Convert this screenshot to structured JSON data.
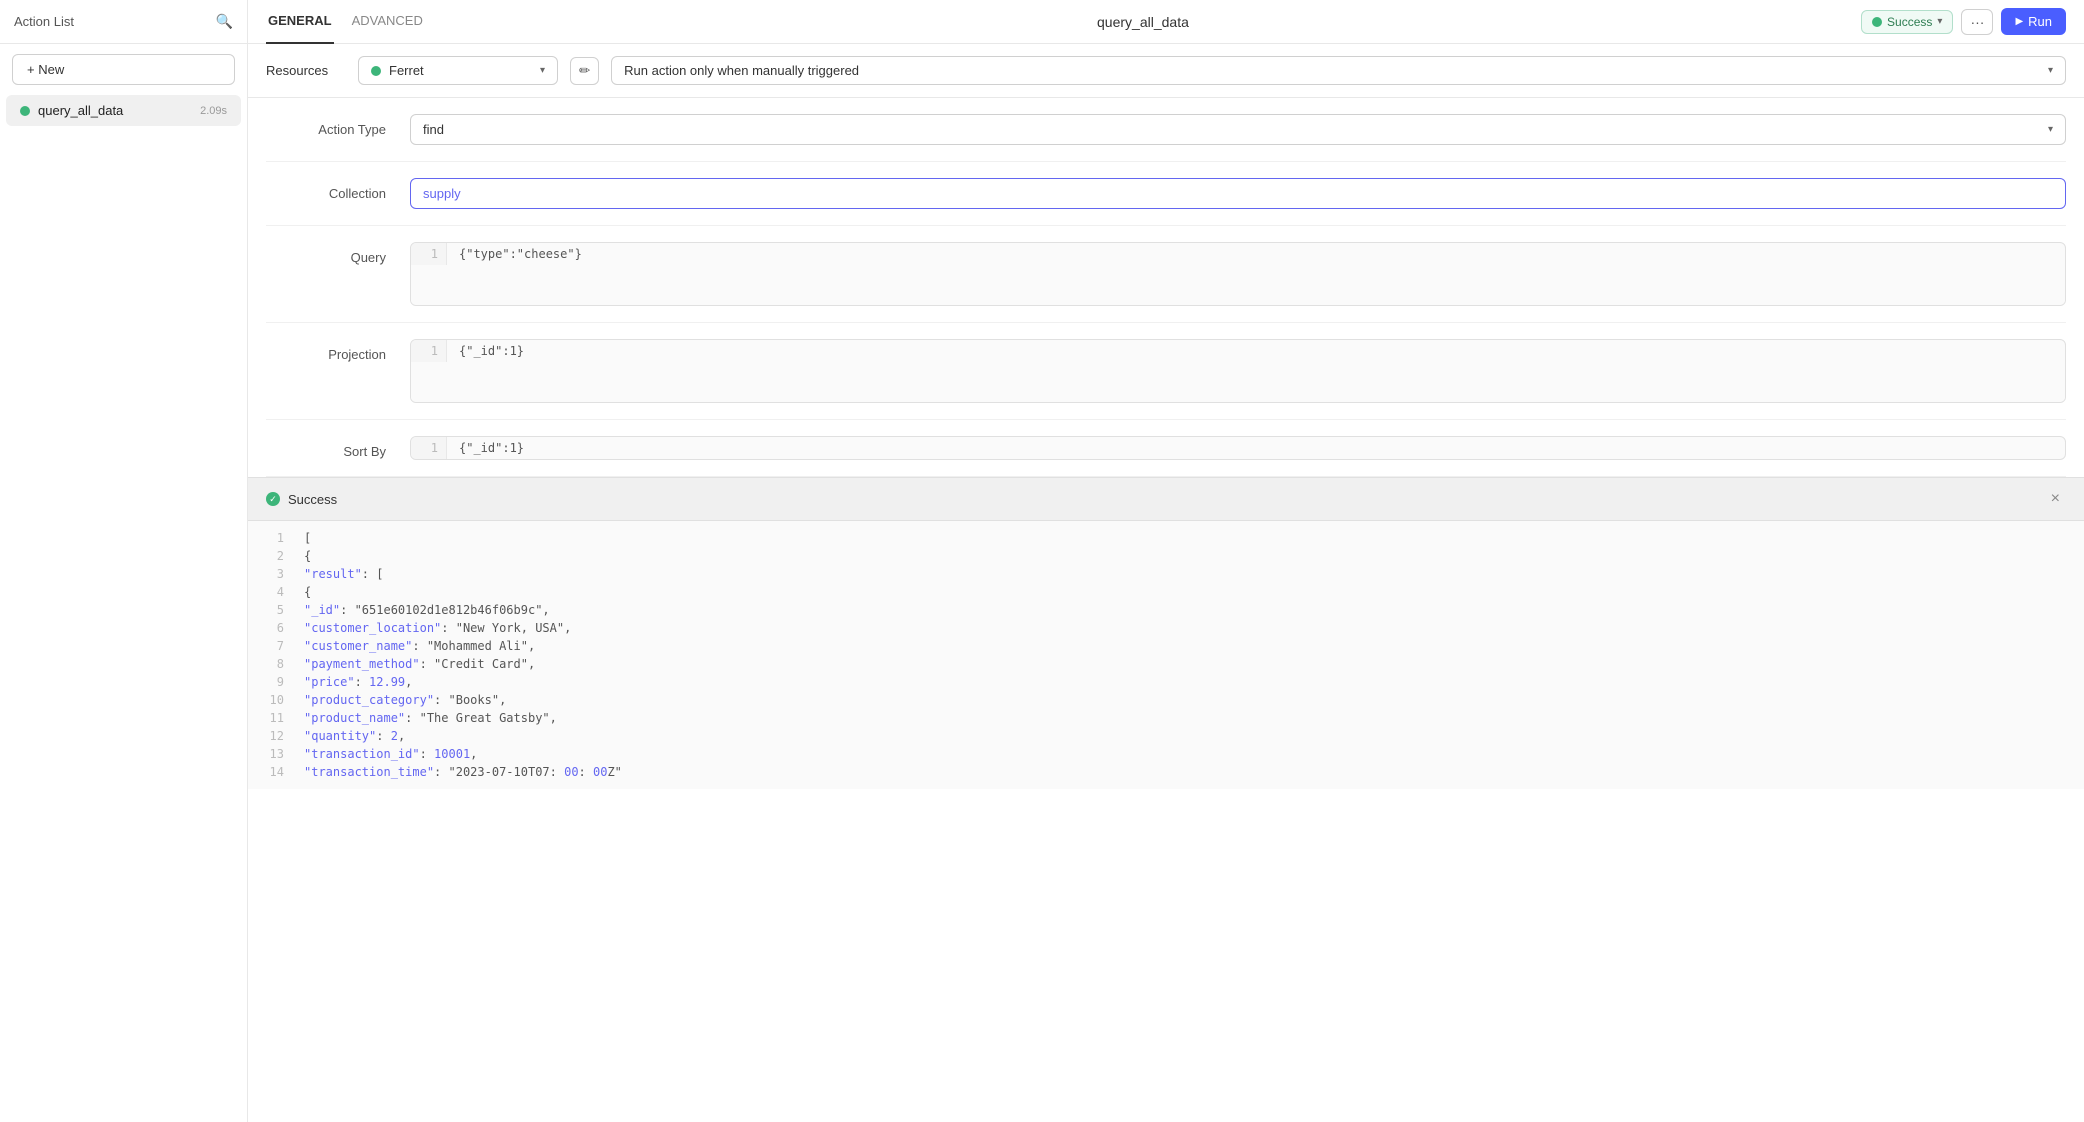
{
  "sidebar": {
    "title": "Action List",
    "new_button": "+ New",
    "items": [
      {
        "name": "query_all_data",
        "time": "2.09s",
        "active": true
      }
    ]
  },
  "topbar": {
    "tabs": [
      {
        "label": "GENERAL",
        "active": true
      },
      {
        "label": "ADVANCED",
        "active": false
      }
    ],
    "action_name": "query_all_data",
    "success_label": "Success",
    "more_label": "···",
    "run_label": "Run"
  },
  "resources": {
    "label": "Resources",
    "ferret_name": "Ferret",
    "trigger_label": "Run action only when manually triggered"
  },
  "form": {
    "action_type_label": "Action Type",
    "action_type_value": "find",
    "collection_label": "Collection",
    "collection_value": "supply",
    "query_label": "Query",
    "query_line1": "{\"type\":\"cheese\"}",
    "projection_label": "Projection",
    "projection_line1": "{\"_id\":1}",
    "sort_by_label": "Sort By",
    "sort_by_line1": "{\"_id\":1}"
  },
  "result": {
    "title": "Success",
    "lines": [
      {
        "num": 1,
        "code": "["
      },
      {
        "num": 2,
        "code": "  {"
      },
      {
        "num": 3,
        "code": "    \"result\": ["
      },
      {
        "num": 4,
        "code": "      {"
      },
      {
        "num": 5,
        "code": "        \"_id\": \"651e60102d1e812b46f06b9c\","
      },
      {
        "num": 6,
        "code": "        \"customer_location\": \"New York, USA\","
      },
      {
        "num": 7,
        "code": "        \"customer_name\": \"Mohammed Ali\","
      },
      {
        "num": 8,
        "code": "        \"payment_method\": \"Credit Card\","
      },
      {
        "num": 9,
        "code": "        \"price\": 12.99,"
      },
      {
        "num": 10,
        "code": "        \"product_category\": \"Books\","
      },
      {
        "num": 11,
        "code": "        \"product_name\": \"The Great Gatsby\","
      },
      {
        "num": 12,
        "code": "        \"quantity\": 2,"
      },
      {
        "num": 13,
        "code": "        \"transaction_id\": 10001,"
      },
      {
        "num": 14,
        "code": "        \"transaction_time\": \"2023-07-10T07:00:00Z\""
      }
    ]
  }
}
